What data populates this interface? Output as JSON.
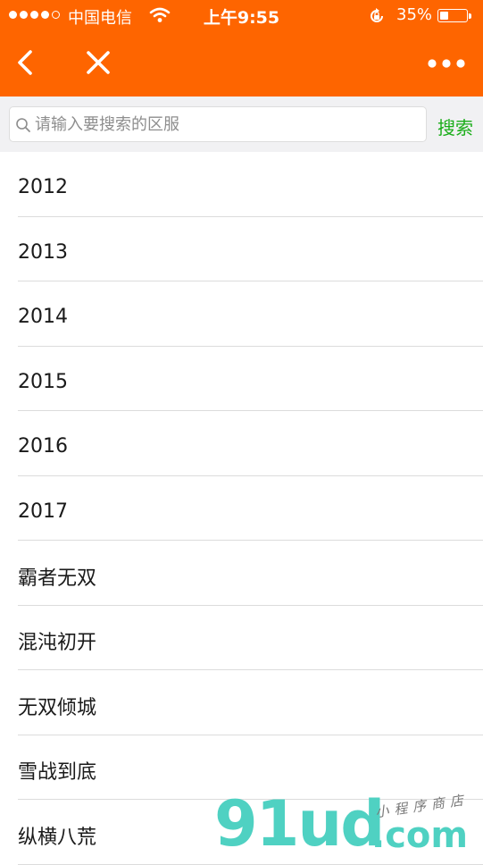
{
  "status_bar": {
    "carrier": "中国电信",
    "time": "上午9:55",
    "battery_percent_text": "35%",
    "battery_level": 0.35,
    "signal_bars_filled": 4,
    "signal_bars_total": 5
  },
  "nav": {
    "back_icon": "chevron-left-icon",
    "close_icon": "close-icon",
    "more_icon": "more-dots-icon"
  },
  "search": {
    "placeholder": "请输入要搜索的区服",
    "value": "",
    "button_label": "搜索"
  },
  "servers": [
    {
      "label": "2012"
    },
    {
      "label": "2013"
    },
    {
      "label": "2014"
    },
    {
      "label": "2015"
    },
    {
      "label": "2016"
    },
    {
      "label": "2017"
    },
    {
      "label": "霸者无双"
    },
    {
      "label": "混沌初开"
    },
    {
      "label": "无双倾城"
    },
    {
      "label": "雪战到底"
    },
    {
      "label": "纵横八荒"
    }
  ],
  "watermark": {
    "logo": "91ud",
    "domain": ".com",
    "tagline": "小程序商店"
  },
  "colors": {
    "header_bg": "#fe6500",
    "search_button": "#1aad19",
    "watermark": "#4fd1c2"
  }
}
